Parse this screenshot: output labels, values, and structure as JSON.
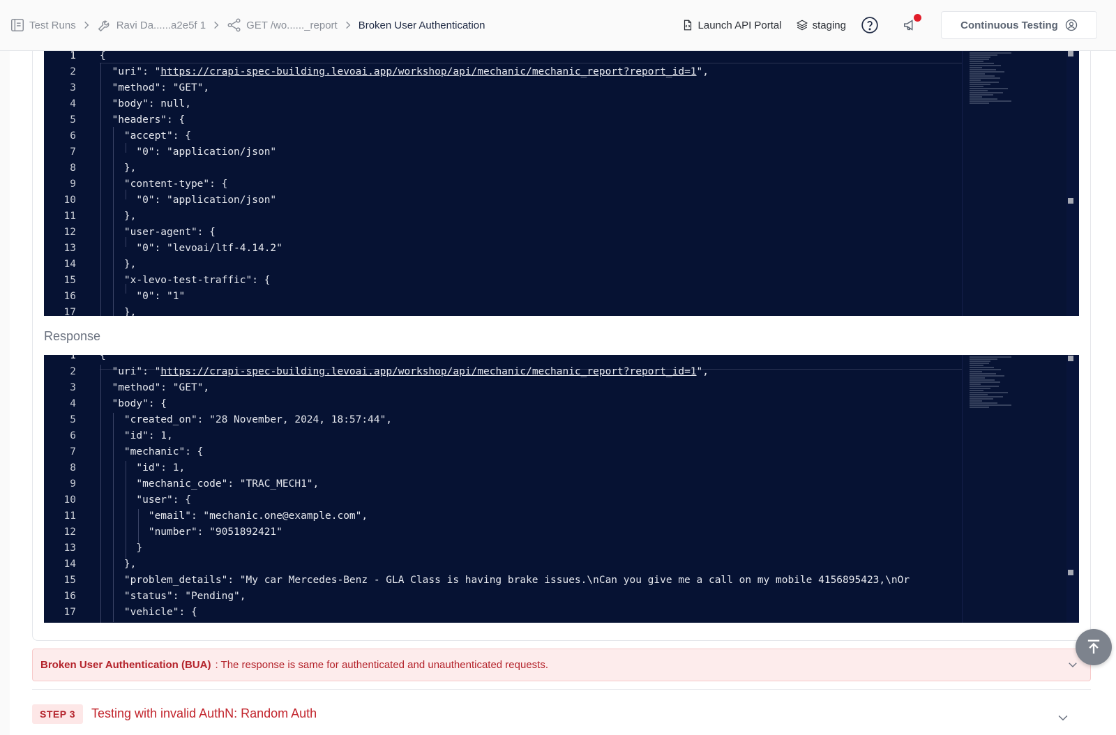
{
  "breadcrumb": {
    "items": [
      {
        "label": "Test Runs",
        "icon": "list-icon"
      },
      {
        "label": "Ravi Da......a2e5f 1",
        "icon": "wrench-icon"
      },
      {
        "label": "GET /wo......_report",
        "icon": "share-nodes-icon"
      },
      {
        "label": "Broken User Authentication",
        "icon": ""
      }
    ]
  },
  "header": {
    "launch_label": "Launch API Portal",
    "env_label": "staging",
    "continuous_label": "Continuous Testing"
  },
  "request_code": {
    "lines": [
      {
        "n": "1",
        "text": "{"
      },
      {
        "n": "2",
        "text": "  \"uri\": \"",
        "url": "https://crapi-spec-building.levoai.app/workshop/api/mechanic/mechanic_report?report_id=1",
        "after": "\","
      },
      {
        "n": "3",
        "text": "  \"method\": \"GET\","
      },
      {
        "n": "4",
        "text": "  \"body\": null,"
      },
      {
        "n": "5",
        "text": "  \"headers\": {"
      },
      {
        "n": "6",
        "text": "    \"accept\": {"
      },
      {
        "n": "7",
        "text": "      \"0\": \"application/json\""
      },
      {
        "n": "8",
        "text": "    },"
      },
      {
        "n": "9",
        "text": "    \"content-type\": {"
      },
      {
        "n": "10",
        "text": "      \"0\": \"application/json\""
      },
      {
        "n": "11",
        "text": "    },"
      },
      {
        "n": "12",
        "text": "    \"user-agent\": {"
      },
      {
        "n": "13",
        "text": "      \"0\": \"levoai/ltf-4.14.2\""
      },
      {
        "n": "14",
        "text": "    },"
      },
      {
        "n": "15",
        "text": "    \"x-levo-test-traffic\": {"
      },
      {
        "n": "16",
        "text": "      \"0\": \"1\""
      },
      {
        "n": "17",
        "text": "    },"
      }
    ]
  },
  "response_label": "Response",
  "response_code": {
    "lines": [
      {
        "n": "1",
        "text": "{"
      },
      {
        "n": "2",
        "text": "  \"uri\": \"",
        "url": "https://crapi-spec-building.levoai.app/workshop/api/mechanic/mechanic_report?report_id=1",
        "after": "\","
      },
      {
        "n": "3",
        "text": "  \"method\": \"GET\","
      },
      {
        "n": "4",
        "text": "  \"body\": {"
      },
      {
        "n": "5",
        "text": "    \"created_on\": \"28 November, 2024, 18:57:44\","
      },
      {
        "n": "6",
        "text": "    \"id\": 1,"
      },
      {
        "n": "7",
        "text": "    \"mechanic\": {"
      },
      {
        "n": "8",
        "text": "      \"id\": 1,"
      },
      {
        "n": "9",
        "text": "      \"mechanic_code\": \"TRAC_MECH1\","
      },
      {
        "n": "10",
        "text": "      \"user\": {"
      },
      {
        "n": "11",
        "text": "        \"email\": \"mechanic.one@example.com\","
      },
      {
        "n": "12",
        "text": "        \"number\": \"9051892421\""
      },
      {
        "n": "13",
        "text": "      }"
      },
      {
        "n": "14",
        "text": "    },"
      },
      {
        "n": "15",
        "text": "    \"problem_details\": \"My car Mercedes-Benz - GLA Class is having brake issues.\\nCan you give me a call on my mobile 4156895423,\\nOr"
      },
      {
        "n": "16",
        "text": "    \"status\": \"Pending\","
      },
      {
        "n": "17",
        "text": "    \"vehicle\": {"
      }
    ]
  },
  "alert": {
    "title": "Broken User Authentication (BUA)",
    "message": ": The response is same for authenticated and unauthenticated requests."
  },
  "step": {
    "badge": "STEP 3",
    "title": "Testing with invalid AuthN: Random Auth"
  }
}
